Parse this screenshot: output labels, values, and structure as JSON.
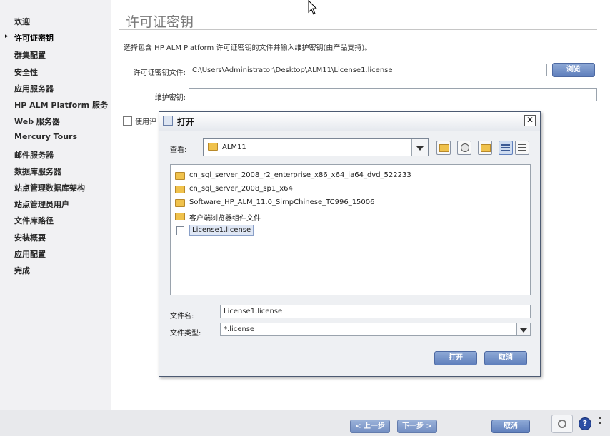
{
  "sidebar": {
    "items": [
      {
        "label": "欢迎"
      },
      {
        "label": "许可证密钥"
      },
      {
        "label": "群集配置"
      },
      {
        "label": "安全性"
      },
      {
        "label": "应用服务器"
      },
      {
        "label": "HP ALM Platform 服务"
      },
      {
        "label": "Web 服务器"
      },
      {
        "label": "Mercury Tours"
      },
      {
        "label": "邮件服务器"
      },
      {
        "label": "数据库服务器"
      },
      {
        "label": "站点管理数据库架构"
      },
      {
        "label": "站点管理员用户"
      },
      {
        "label": "文件库路径"
      },
      {
        "label": "安装概要"
      },
      {
        "label": "应用配置"
      },
      {
        "label": "完成"
      }
    ],
    "active_marker": "▸"
  },
  "main": {
    "title": "许可证密钥",
    "instruction": "选择包含 HP ALM Platform 许可证密钥的文件并输入维护密钥(由产品支持)。",
    "license_file_label": "许可证密钥文件:",
    "license_file_value": "C:\\Users\\Administrator\\Desktop\\ALM11\\License1.license",
    "browse_button": "浏览",
    "maintenance_key_label": "维护密钥:",
    "maintenance_key_value": "",
    "use_checkbox_label": "使用评"
  },
  "dialog": {
    "title": "打开",
    "close_glyph": "✕",
    "look_in_label": "查看:",
    "look_in_value": "ALM11",
    "files": [
      {
        "name": "cn_sql_server_2008_r2_enterprise_x86_x64_ia64_dvd_522233",
        "type": "folder"
      },
      {
        "name": "cn_sql_server_2008_sp1_x64",
        "type": "folder"
      },
      {
        "name": "Software_HP_ALM_11.0_SimpChinese_TC996_15006",
        "type": "folder"
      },
      {
        "name": "客户端浏览器组件文件",
        "type": "folder"
      },
      {
        "name": "License1.license",
        "type": "file",
        "selected": true
      }
    ],
    "filename_label": "文件名:",
    "filename_value": "License1.license",
    "filetype_label": "文件类型:",
    "filetype_value": "*.license",
    "open_button": "打开",
    "cancel_button": "取消"
  },
  "footer": {
    "buttons": [
      "< 上一步",
      "下一步 >",
      "取消"
    ],
    "help_glyph": "?"
  },
  "colors": {
    "accent_blue": "#6f8dc5",
    "dialog_border": "#4c5a72",
    "sidebar_bg": "#f1f1f3"
  }
}
